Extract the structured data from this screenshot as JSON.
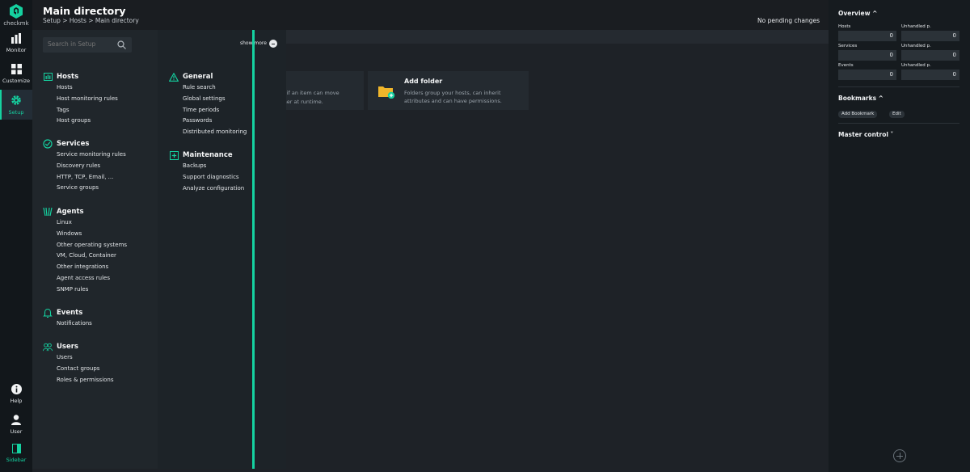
{
  "app": {
    "logo_text": "checkmk"
  },
  "nav": {
    "monitor": "Monitor",
    "customize": "Customize",
    "setup": "Setup",
    "help": "Help",
    "user": "User",
    "sidebar": "Sidebar"
  },
  "header": {
    "title": "Main directory",
    "breadcrumb": "Setup > Hosts > Main directory",
    "pending": "No pending changes"
  },
  "cards": {
    "partial_line1": "ters if an item can move",
    "partial_line2": "gether at runtime.",
    "add_folder_title": "Add folder",
    "add_folder_line1": "Folders group your hosts, can inherit",
    "add_folder_line2": "attributes and can have permissions."
  },
  "menu": {
    "search_placeholder": "Search in Setup",
    "show_more": "show more",
    "topics": {
      "hosts": {
        "title": "Hosts",
        "items": [
          "Hosts",
          "Host monitoring rules",
          "Tags",
          "Host groups"
        ]
      },
      "services": {
        "title": "Services",
        "items": [
          "Service monitoring rules",
          "Discovery rules",
          "HTTP, TCP, Email, ...",
          "Service groups"
        ]
      },
      "agents": {
        "title": "Agents",
        "items": [
          "Linux",
          "Windows",
          "Other operating systems",
          "VM, Cloud, Container",
          "Other integrations",
          "Agent access rules",
          "SNMP rules"
        ]
      },
      "events": {
        "title": "Events",
        "items": [
          "Notifications"
        ]
      },
      "users": {
        "title": "Users",
        "items": [
          "Users",
          "Contact groups",
          "Roles & permissions"
        ]
      },
      "general": {
        "title": "General",
        "items": [
          "Rule search",
          "Global settings",
          "Time periods",
          "Passwords",
          "Distributed monitoring"
        ]
      },
      "maintenance": {
        "title": "Maintenance",
        "items": [
          "Backups",
          "Support diagnostics",
          "Analyze configuration"
        ]
      }
    }
  },
  "sidebar": {
    "overview": {
      "title": "Overview ^",
      "hosts_label": "Hosts",
      "hosts_value": "0",
      "hosts_unhandled_label": "Unhandled p.",
      "hosts_unhandled_value": "0",
      "services_label": "Services",
      "services_value": "0",
      "services_unhandled_label": "Unhandled p.",
      "services_unhandled_value": "0",
      "events_label": "Events",
      "events_value": "0",
      "events_unhandled_label": "Unhandled p.",
      "events_unhandled_value": "0"
    },
    "bookmarks": {
      "title": "Bookmarks ^",
      "add": "Add Bookmark",
      "edit": "Edit"
    },
    "master_control": {
      "title": "Master control ˅"
    }
  },
  "colors": {
    "accent": "#15d1a0",
    "folder": "#f1b62b"
  }
}
